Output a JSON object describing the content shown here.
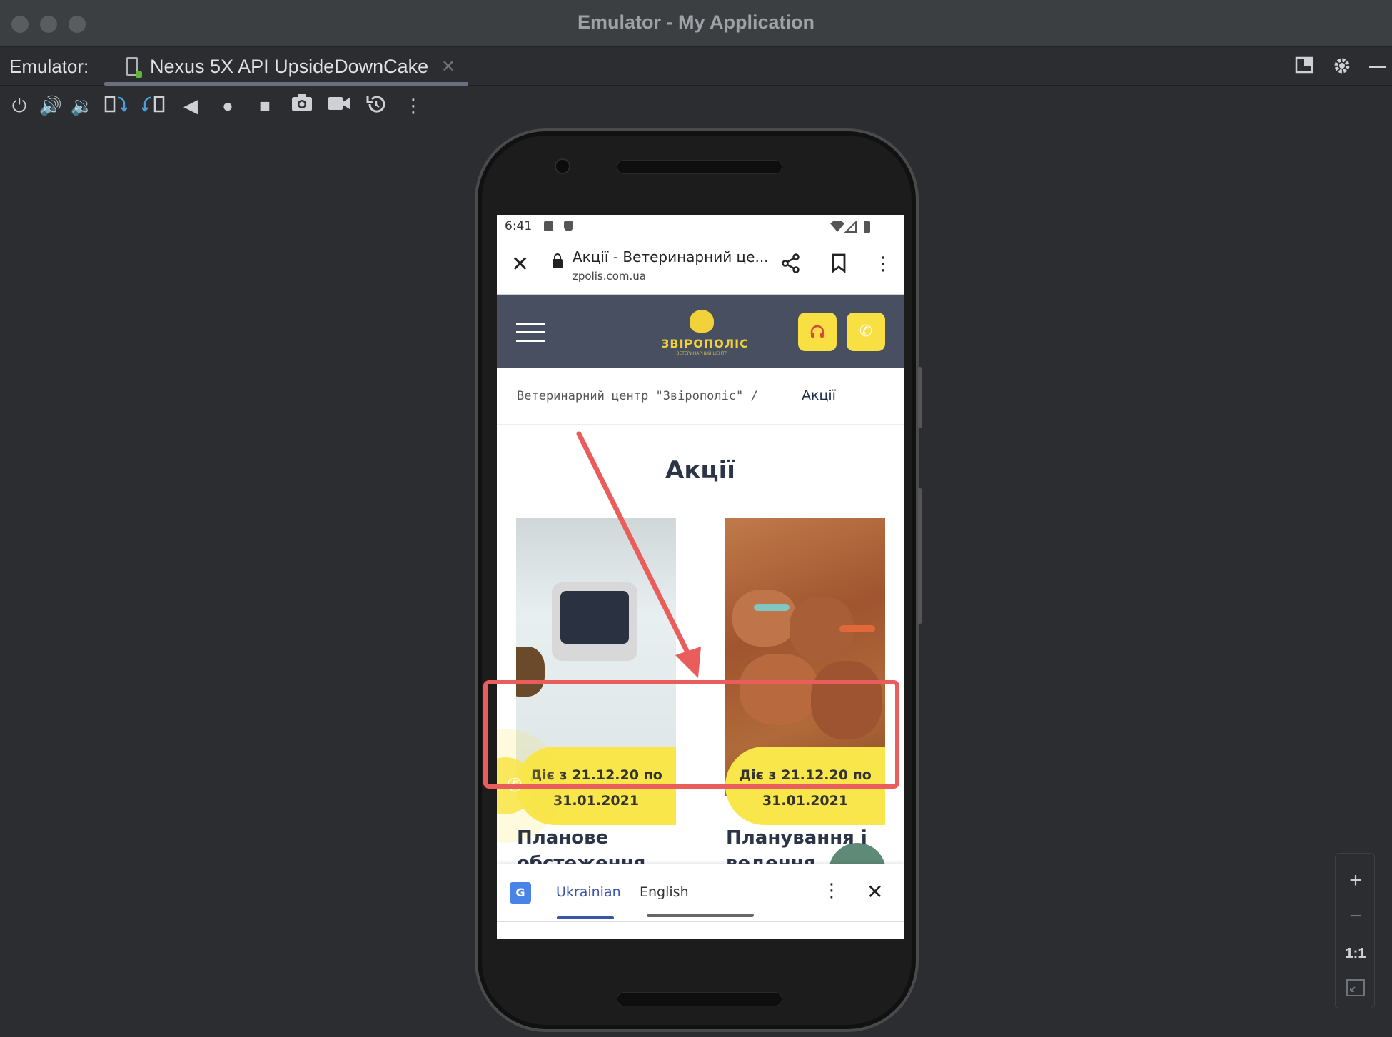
{
  "window": {
    "title": "Emulator - My Application"
  },
  "tabbar": {
    "label": "Emulator:",
    "tab_label": "Nexus 5X API UpsideDownCake",
    "tab_close": "✕"
  },
  "toolbar": {
    "icons": [
      "power-icon",
      "volume-up-icon",
      "volume-down-icon",
      "rotate-left-icon",
      "rotate-right-icon",
      "back-icon",
      "home-icon",
      "overview-icon",
      "screenshot-icon",
      "screen-record-icon",
      "snapshot-icon",
      "more-icon"
    ]
  },
  "phone": {
    "status": {
      "time": "6:41"
    },
    "chrome": {
      "page_title": "Акції - Ветеринарний це...",
      "url": "zpolis.com.ua"
    },
    "site": {
      "logo_text": "ЗВІРОПОЛІС",
      "logo_sub": "ВЕТЕРИНАРНИЙ ЦЕНТР",
      "breadcrumb_link": "Ветеринарний центр \"Звірополіс\" /",
      "breadcrumb_current": "Акції",
      "heading": "Акції",
      "cards": [
        {
          "badge_line1": "Діє з 21.12.20 по",
          "badge_line2": "31.01.2021",
          "title_line1": "Планове",
          "title_line2": "обстеження"
        },
        {
          "badge_line1": "Діє з 21.12.20 по",
          "badge_line2": "31.01.2021",
          "title_line1": "Планування і",
          "title_line2": "ведення"
        }
      ]
    },
    "translate_bar": {
      "lang_active": "Ukrainian",
      "lang_other": "English",
      "active_color": "#3a55a8"
    }
  },
  "zoom": {
    "plus": "+",
    "minus": "−",
    "one_to_one": "1:1"
  },
  "colors": {
    "annotation_red": "#ea5d5d",
    "badge_yellow": "#f8e64a",
    "site_header": "#474f61"
  }
}
